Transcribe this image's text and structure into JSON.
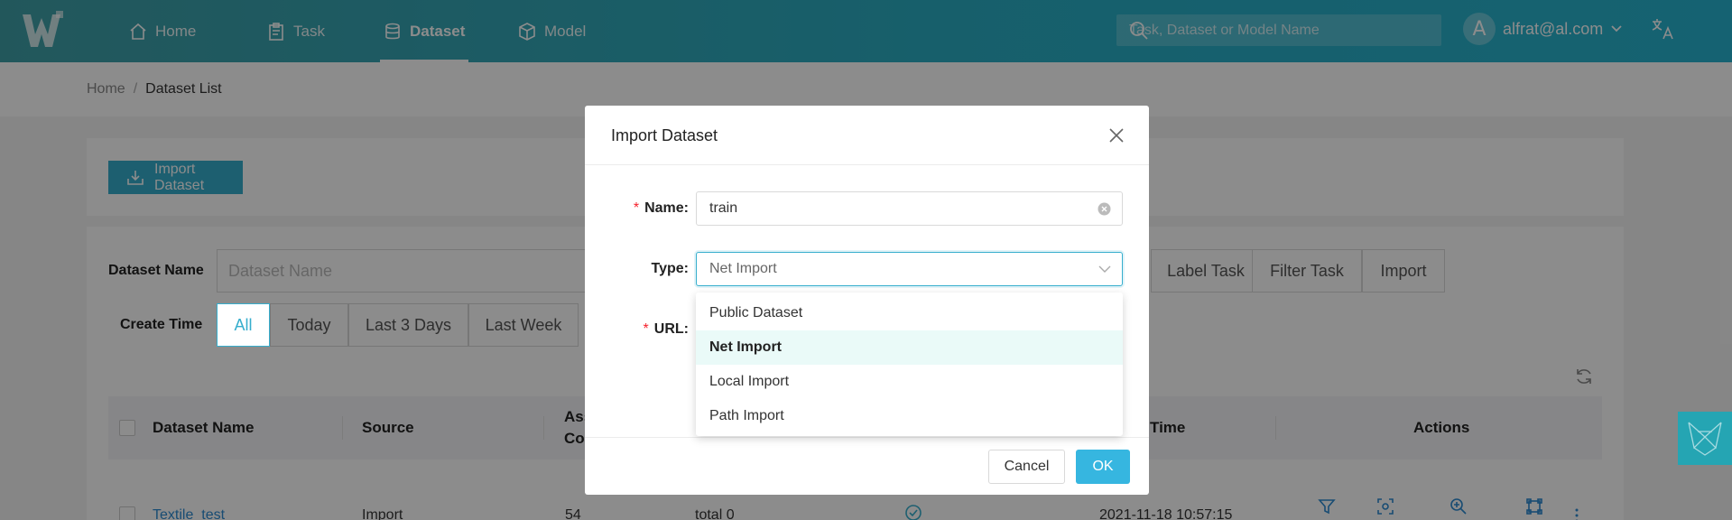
{
  "nav": {
    "items": [
      {
        "label": "Home",
        "icon": "home-icon"
      },
      {
        "label": "Task",
        "icon": "clipboard-icon"
      },
      {
        "label": "Dataset",
        "icon": "database-icon",
        "active": true
      },
      {
        "label": "Model",
        "icon": "cube-icon"
      }
    ],
    "search_placeholder": "Task, Dataset or Model Name",
    "user_initial": "A",
    "user_email": "alfrat@al.com"
  },
  "breadcrumb": {
    "home": "Home",
    "separator": "/",
    "current": "Dataset List"
  },
  "toolbar": {
    "import_label": "Import Dataset"
  },
  "filters": {
    "name_label": "Dataset Name",
    "name_placeholder": "Dataset Name",
    "source_options": [
      "Label Task",
      "Filter Task",
      "Import"
    ],
    "time_label": "Create Time",
    "time_options": [
      "All",
      "Today",
      "Last 3 Days",
      "Last Week"
    ],
    "time_selected": "All"
  },
  "table": {
    "headers": {
      "name": "Dataset Name",
      "source": "Source",
      "assets_line1": "Ass",
      "assets_line2": "Co",
      "time": "Time",
      "actions": "Actions"
    },
    "row": {
      "name": "Textile_test",
      "source": "Import",
      "assets": "54",
      "total": "total 0",
      "time": "2021-11-18 10:57:15"
    }
  },
  "modal": {
    "title": "Import Dataset",
    "name_label": "Name",
    "name_value": "train",
    "type_label": "Type",
    "type_value": "Net Import",
    "url_label": "URL",
    "colon": ":",
    "required_mark": "*",
    "type_options": [
      "Public Dataset",
      "Net Import",
      "Local Import",
      "Path Import"
    ],
    "type_selected": "Net Import",
    "cancel_label": "Cancel",
    "ok_label": "OK"
  },
  "colors": {
    "header_start": "#3f9fa7",
    "header_end": "#27b3cf",
    "accent": "#36aecd",
    "ok_button": "#36b6e0",
    "required": "#f5222d"
  }
}
